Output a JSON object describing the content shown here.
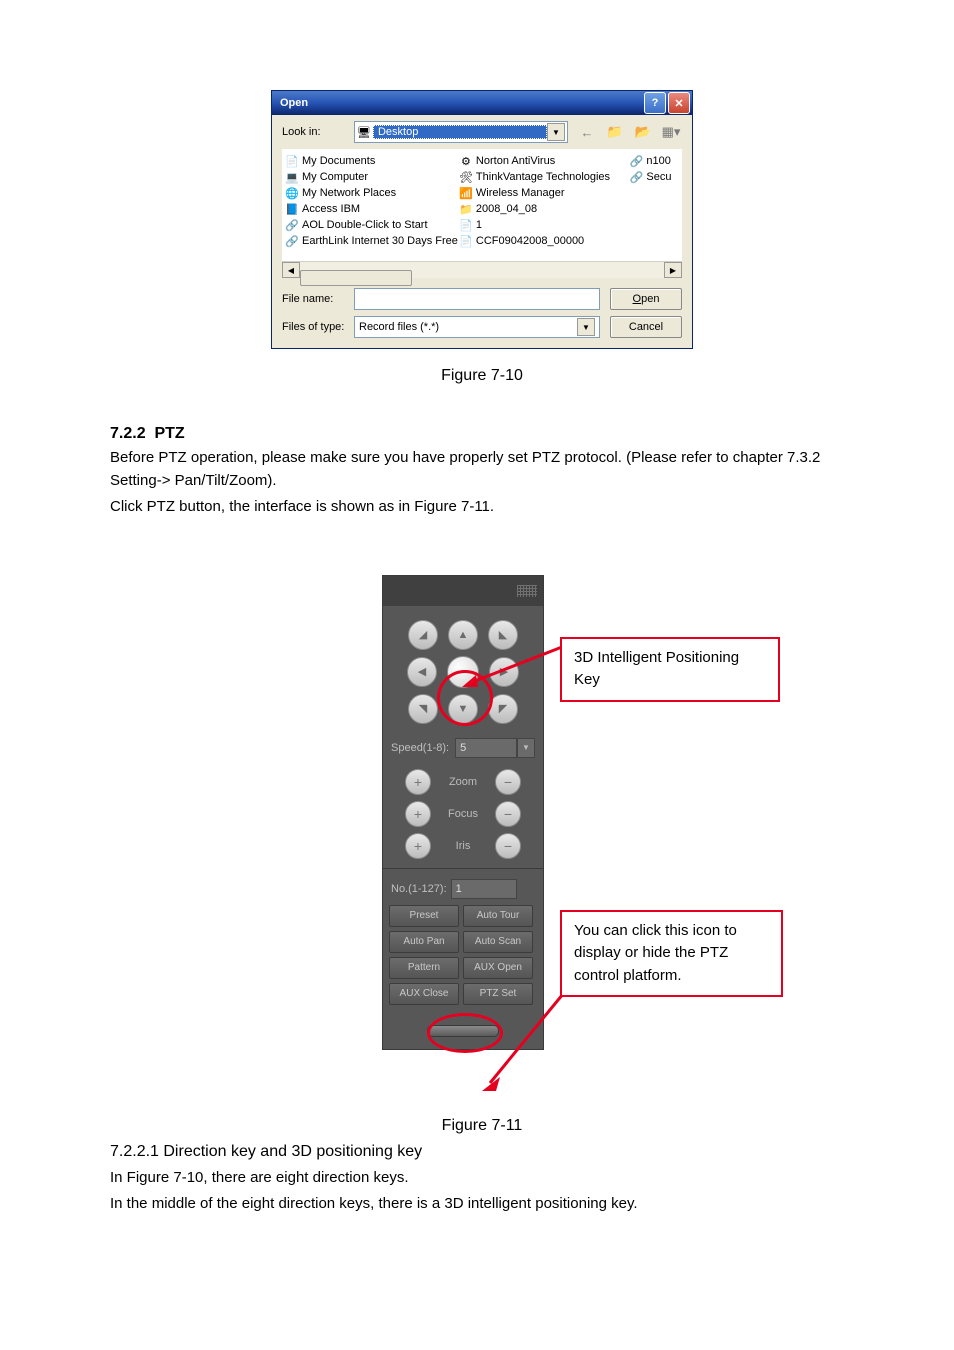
{
  "dialog": {
    "title": "Open",
    "look_in_label": "Look in:",
    "look_in_value": "Desktop",
    "files_col1": [
      {
        "icon": "📄",
        "name": "My Documents"
      },
      {
        "icon": "💻",
        "name": "My Computer"
      },
      {
        "icon": "🌐",
        "name": "My Network Places"
      },
      {
        "icon": "📘",
        "name": "Access IBM"
      },
      {
        "icon": "🔗",
        "name": "AOL Double-Click to Start"
      },
      {
        "icon": "🔗",
        "name": "EarthLink Internet 30 Days Free"
      }
    ],
    "files_col2": [
      {
        "icon": "⚙",
        "name": "Norton AntiVirus"
      },
      {
        "icon": "🛠",
        "name": "ThinkVantage Technologies"
      },
      {
        "icon": "📶",
        "name": "Wireless Manager"
      },
      {
        "icon": "📁",
        "name": "2008_04_08"
      },
      {
        "icon": "📄",
        "name": "1"
      },
      {
        "icon": "📄",
        "name": "CCF09042008_00000"
      }
    ],
    "files_col3": [
      {
        "icon": "🔗",
        "name": "n100"
      },
      {
        "icon": "🔗",
        "name": "Secu"
      }
    ],
    "file_name_label": "File name:",
    "file_name_value": "",
    "file_type_label": "Files of type:",
    "file_type_value": "Record files (*.*)",
    "open_btn": "Open",
    "cancel_btn": "Cancel"
  },
  "fig1_caption": "Figure 7-10",
  "section": {
    "num": "7.2.2",
    "title": "PTZ",
    "p1": "Before PTZ operation, please make sure you have properly set PTZ protocol. (Please refer to chapter 7.3.2 Setting-> Pan/Tilt/Zoom).",
    "p2": "Click PTZ button, the interface is shown as in Figure 7-11."
  },
  "ptz": {
    "speed_label": "Speed(1-8):",
    "speed_value": "5",
    "zoom": "Zoom",
    "focus": "Focus",
    "iris": "Iris",
    "no_label": "No.(1-127):",
    "no_value": "1",
    "buttons": [
      "Preset",
      "Auto Tour",
      "Auto Pan",
      "Auto Scan",
      "Pattern",
      "AUX Open",
      "AUX Close",
      "PTZ Set"
    ]
  },
  "callouts": {
    "c1": "3D Intelligent Positioning Key",
    "c2": "You can click this icon to display or hide the PTZ control platform."
  },
  "fig2_caption": "Figure 7-11",
  "sub": {
    "num_title": "7.2.2.1  Direction key and 3D positioning key",
    "p1": "In Figure 7-10, there are eight direction keys.",
    "p2": "In the middle of the eight direction keys, there is a 3D intelligent positioning key."
  }
}
